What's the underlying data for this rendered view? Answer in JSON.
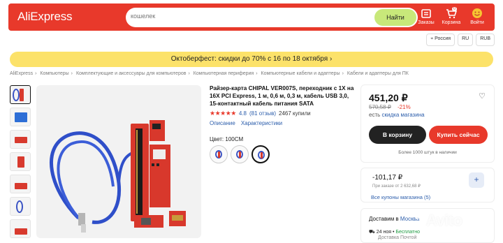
{
  "header": {
    "logo": "AliExpress",
    "search_placeholder": "кошелек",
    "search_button": "Найти",
    "orders_label": "Заказы",
    "cart_label": "Корзина",
    "cart_count": "0",
    "profile_label": "Войти"
  },
  "locale": {
    "country": "Россия",
    "language": "RU",
    "currency": "RUB"
  },
  "promo_banner": "Октоберфест: скидки до 70% с 16 по 18 октября",
  "breadcrumbs": [
    "AliExpress",
    "Компьютеры",
    "Комплектующие и аксессуары для компьютеров",
    "Компьютерная периферия",
    "Компьютерные кабели и адаптеры",
    "Кабели и адаптеры для ПК"
  ],
  "product": {
    "title": "Райзер-карта CHIPAL VER007S, переходник с 1X на 16X PCI Express, 1 м, 0,6 м, 0,3 м, кабель USB 3,0, 15-контактный кабель питания SATA",
    "stars": "★★★★★",
    "rating": "4.8",
    "reviews": "(81 отзыв)",
    "bought": "2467 купили",
    "tab_description": "Описание",
    "tab_specs": "Характеристики",
    "color_label": "Цвет: 100CM",
    "rating_fraction": 0.96
  },
  "buy_box": {
    "price": "451,20 ₽",
    "old_price": "570,58 ₽",
    "discount": "-21%",
    "store_discount_prefix": "есть",
    "store_discount_link": "скидка магазина",
    "add_to_cart": "В корзину",
    "buy_now": "Купить сейчас",
    "sold_note": "Более 1000 штук в наличии"
  },
  "coupon": {
    "amount": "-101,17 ₽",
    "note": "При заказе от 2 632,68 ₽",
    "link": "Все купоны магазина (5)"
  },
  "delivery": {
    "prefix": "Доставим в",
    "city": "Москва",
    "date": "24 ноя •",
    "free": "Бесплатно",
    "sub": "Доставка Почтой"
  },
  "watermark": "Avito",
  "colors": {
    "brand_red": "#e8392b",
    "search_button": "#c8e87a",
    "promo_yellow": "#fce26a",
    "link_blue": "#2b5dab"
  }
}
